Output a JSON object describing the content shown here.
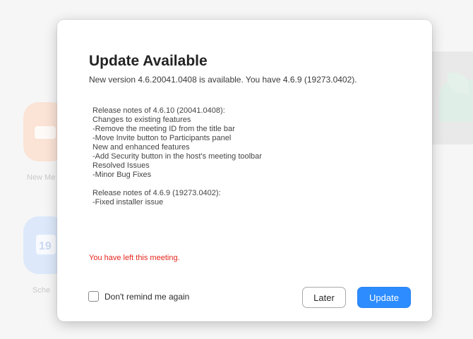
{
  "background": {
    "new_meeting_label": "New Me",
    "schedule_label": "Sche",
    "calendar_day": "19"
  },
  "dialog": {
    "title": "Update Available",
    "subtitle": "New version 4.6.20041.0408 is available. You have 4.6.9 (19273.0402).",
    "release_notes": [
      "Release notes of 4.6.10 (20041.0408):",
      "Changes to existing features",
      "-Remove the meeting ID from the title bar",
      "-Move Invite button to Participants panel",
      "New and enhanced features",
      "-Add Security button in the host's meeting toolbar",
      "Resolved Issues",
      "-Minor Bug Fixes",
      "",
      "Release notes of 4.6.9 (19273.0402):",
      "-Fixed installer issue"
    ],
    "status_message": "You have left this meeting.",
    "remind_checkbox_label": "Don't remind me again",
    "remind_checked": false,
    "later_button": "Later",
    "update_button": "Update"
  },
  "colors": {
    "accent": "#2d8cff",
    "status_error": "#e5271f"
  }
}
